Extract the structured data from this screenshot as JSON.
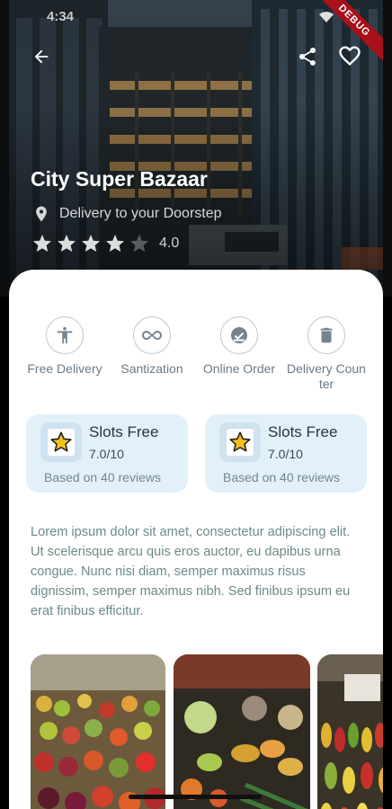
{
  "status_bar": {
    "time": "4:34"
  },
  "debug_banner": "DEBUG",
  "header": {
    "back_icon": "arrow-back-icon",
    "share_icon": "share-icon",
    "favorite_icon": "heart-outline-icon"
  },
  "store": {
    "name": "City Super Bazaar",
    "location_icon": "location-pin-icon",
    "delivery_text": "Delivery to your Doorstep",
    "rating": "4.0",
    "rating_stars_filled": 4,
    "rating_stars_total": 5
  },
  "features": [
    {
      "label": "Free Delivery",
      "icon": "accessibility-icon"
    },
    {
      "label": "Santization",
      "icon": "infinity-icon"
    },
    {
      "label": "Online Order",
      "icon": "check-badge-icon"
    },
    {
      "label": "Delivery Counter",
      "icon": "trash-icon"
    }
  ],
  "slots": [
    {
      "title": "Slots Free",
      "score": "7.0/10",
      "reviews": "Based on 40 reviews",
      "icon": "star-icon"
    },
    {
      "title": "Slots Free",
      "score": "7.0/10",
      "reviews": "Based on 40 reviews",
      "icon": "star-icon"
    }
  ],
  "description": "Lorem ipsum dolor sit amet, consectetur adipiscing elit. Ut scelerisque arcu quis eros auctor, eu dapibus urna congue. Nunc nisi diam, semper maximus risus dignissim, semper maximus nibh. Sed finibus ipsum eu erat finibus efficitur.",
  "gallery": [
    "fruit-stall-photo",
    "vegetable-market-photo",
    "produce-stand-photo"
  ],
  "colors": {
    "card_bg": "#e2f0f9",
    "text_muted": "#6b8a8a",
    "debug_red": "#a8101a"
  }
}
